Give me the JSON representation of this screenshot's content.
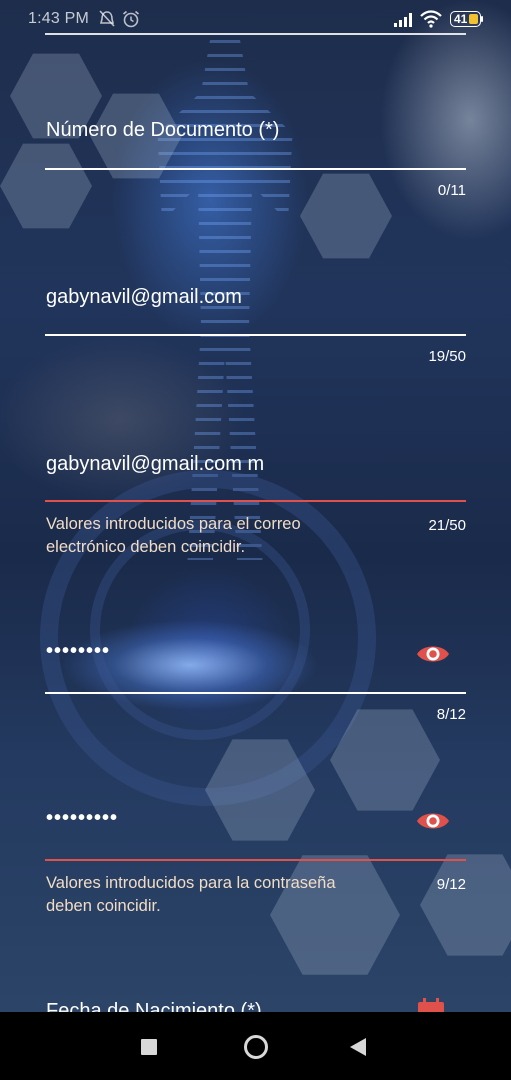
{
  "status_bar": {
    "time": "1:43 PM",
    "battery": "41",
    "icons": [
      "alarm-off-icon",
      "alarm-clock-icon",
      "signal-icon",
      "wifi-icon",
      "battery-icon"
    ]
  },
  "form": {
    "document_number": {
      "label": "Número de Documento (*)",
      "counter": "0/11"
    },
    "email": {
      "value": "gabynavil@gmail.com",
      "counter": "19/50"
    },
    "email_confirm": {
      "value": "gabynavil@gmail.com m",
      "counter": "21/50",
      "error": "Valores introducidos para el correo electrónico deben coincidir."
    },
    "password": {
      "value": "••••••••",
      "counter": "8/12",
      "icon": "eye-icon"
    },
    "password_confirm": {
      "value": "•••••••••",
      "counter": "9/12",
      "error": "Valores introducidos para la contraseña deben coincidir.",
      "icon": "eye-icon"
    },
    "birth_date": {
      "label": "Fecha de Nacimiento (*)",
      "icon": "calendar-icon"
    }
  },
  "colors": {
    "accent_error": "#e0514b",
    "helper_text": "#f1dcc6",
    "text": "#ffffff"
  },
  "nav_bar": {
    "buttons": [
      "recents-square-icon",
      "home-circle-icon",
      "back-triangle-icon"
    ]
  }
}
